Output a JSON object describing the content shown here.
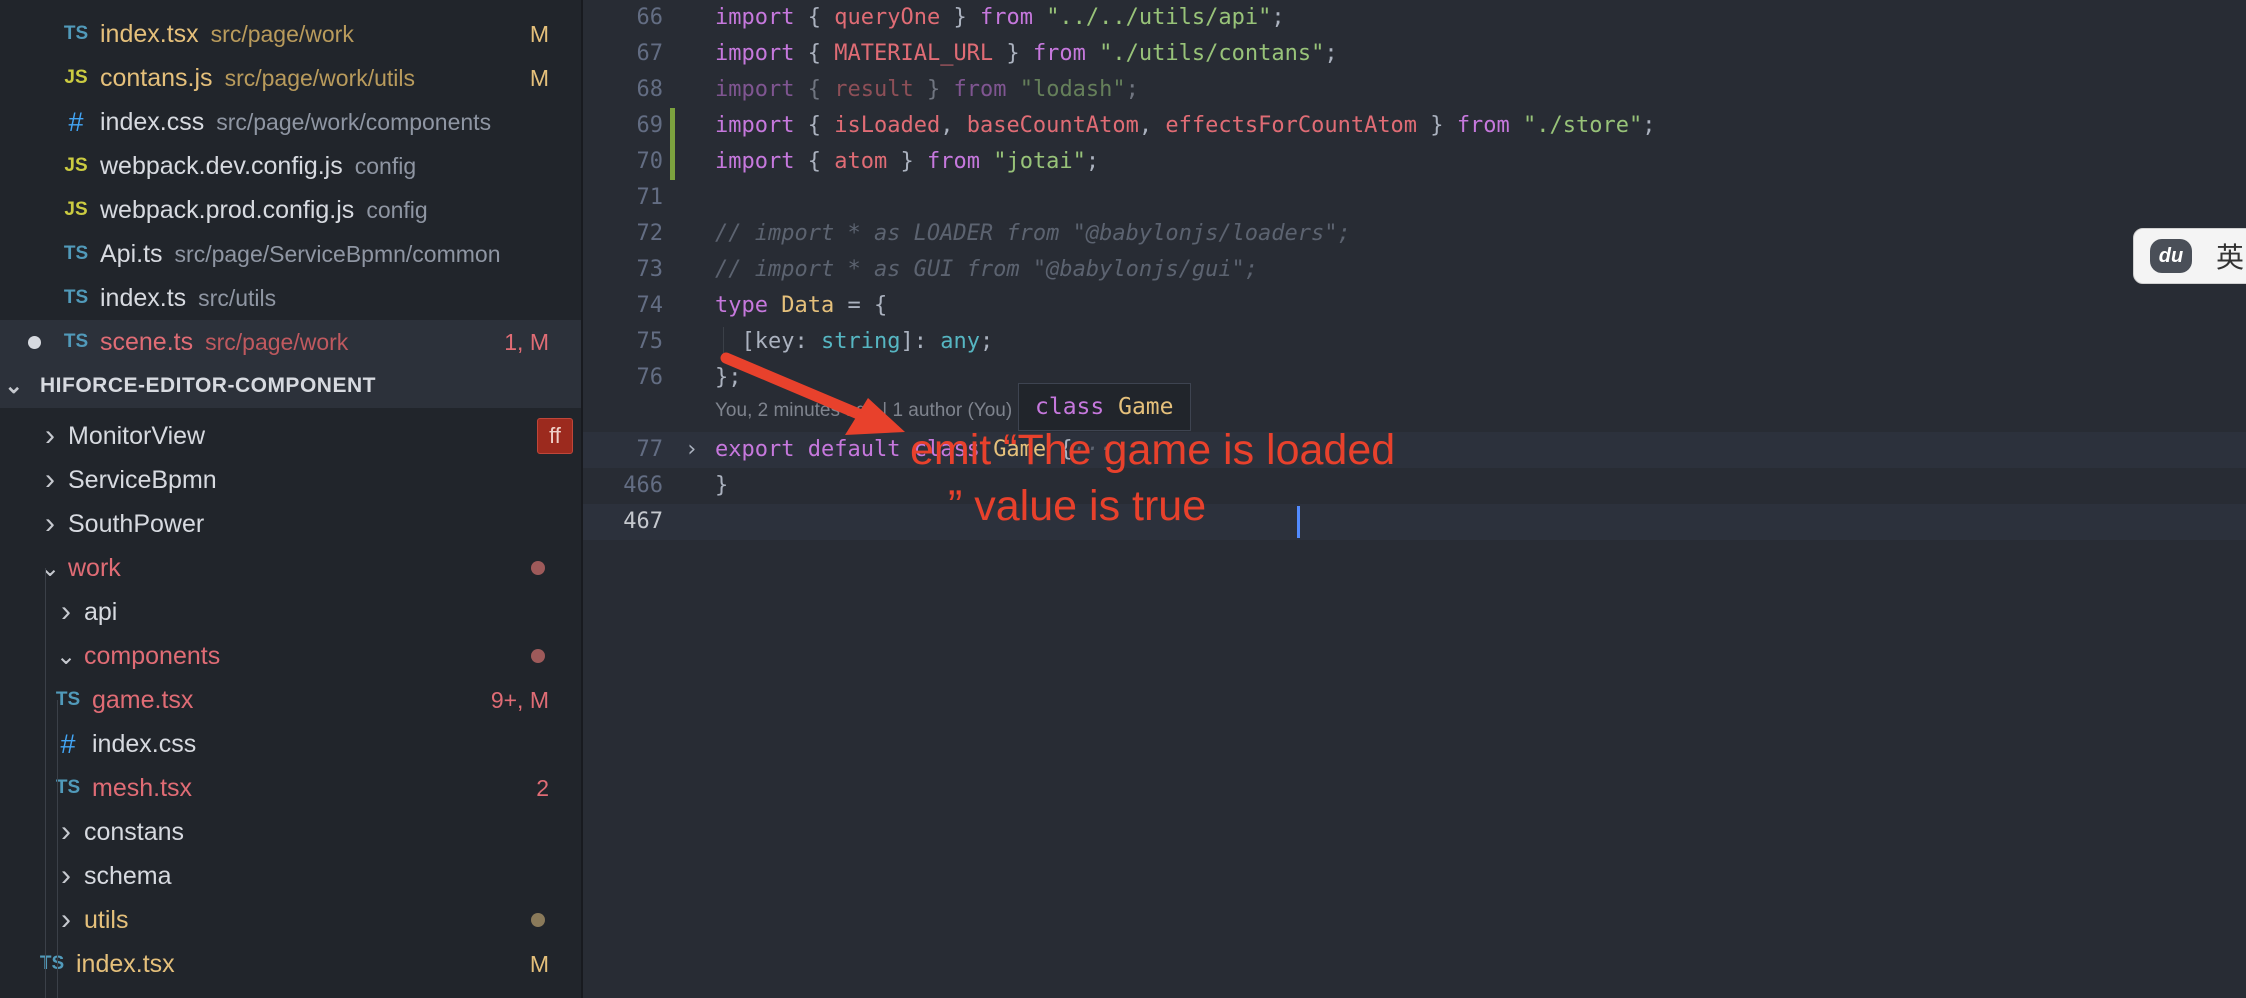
{
  "sidebar": {
    "open_files": [
      {
        "icon": "TS",
        "name": "index.tsx",
        "path": "src/page/work",
        "status": "M",
        "name_color": "#e5c07b",
        "path_color": "#b99b5c",
        "status_color": "#e5c07b"
      },
      {
        "icon": "JS",
        "name": "contans.js",
        "path": "src/page/work/utils",
        "status": "M",
        "name_color": "#e5c07b",
        "path_color": "#b99b5c",
        "status_color": "#e5c07b"
      },
      {
        "icon": "#",
        "name": "index.css",
        "path": "src/page/work/components",
        "status": "",
        "name_color": "#d7dae0",
        "path_color": "#8f96a3"
      },
      {
        "icon": "JS",
        "name": "webpack.dev.config.js",
        "path": "config",
        "status": "",
        "name_color": "#d7dae0",
        "path_color": "#8f96a3"
      },
      {
        "icon": "JS",
        "name": "webpack.prod.config.js",
        "path": "config",
        "status": "",
        "name_color": "#d7dae0",
        "path_color": "#8f96a3"
      },
      {
        "icon": "TS",
        "name": "Api.ts",
        "path": "src/page/ServiceBpmn/common",
        "status": "",
        "name_color": "#d7dae0",
        "path_color": "#8f96a3"
      },
      {
        "icon": "TS",
        "name": "index.ts",
        "path": "src/utils",
        "status": "",
        "name_color": "#d7dae0",
        "path_color": "#8f96a3"
      },
      {
        "icon": "TS",
        "name": "scene.ts",
        "path": "src/page/work",
        "status": "1, M",
        "name_color": "#e06c75",
        "path_color": "#c0595f",
        "status_color": "#e06c75",
        "active": true
      }
    ],
    "section_title": "HIFORCE-EDITOR-COMPONENT",
    "tree": [
      {
        "chevron": "›",
        "name": "MonitorView",
        "badge": "ff",
        "color": "#d7dae0"
      },
      {
        "chevron": "›",
        "name": "ServiceBpmn",
        "color": "#d7dae0"
      },
      {
        "chevron": "›",
        "name": "SouthPower",
        "color": "#d7dae0"
      },
      {
        "chevron": "⌄",
        "name": "work",
        "color": "#e06c75",
        "dot": "#9e5a5a"
      },
      {
        "chevron": "›",
        "name": "api",
        "color": "#d7dae0"
      },
      {
        "chevron": "⌄",
        "name": "components",
        "color": "#e06c75",
        "dot": "#9e5a5a"
      },
      {
        "icon": "TS",
        "name": "game.tsx",
        "color": "#e06c75",
        "status": "9+, M",
        "status_color": "#e06c75"
      },
      {
        "icon": "#",
        "name": "index.css",
        "color": "#d7dae0"
      },
      {
        "icon": "TS",
        "name": "mesh.tsx",
        "color": "#e06c75",
        "status": "2",
        "status_color": "#e06c75"
      },
      {
        "chevron": "›",
        "name": "constans",
        "color": "#d7dae0"
      },
      {
        "chevron": "›",
        "name": "schema",
        "color": "#d7dae0"
      },
      {
        "chevron": "›",
        "name": "utils",
        "color": "#e5c07b",
        "dot": "#8a7a5a"
      },
      {
        "icon": "TS",
        "name": "index.tsx",
        "color": "#e5c07b",
        "status": "M",
        "status_color": "#e5c07b"
      }
    ]
  },
  "editor": {
    "lines": [
      {
        "num": "66",
        "tokens": [
          [
            "k",
            "import"
          ],
          [
            "p",
            " { "
          ],
          [
            "f",
            "queryOne"
          ],
          [
            "p",
            " } "
          ],
          [
            "k",
            "from"
          ],
          [
            "p",
            " "
          ],
          [
            "s",
            "\"../../utils/api\""
          ],
          [
            "p",
            ";"
          ]
        ]
      },
      {
        "num": "67",
        "tokens": [
          [
            "k",
            "import"
          ],
          [
            "p",
            " { "
          ],
          [
            "f",
            "MATERIAL_URL"
          ],
          [
            "p",
            " } "
          ],
          [
            "k",
            "from"
          ],
          [
            "p",
            " "
          ],
          [
            "s",
            "\"./utils/contans\""
          ],
          [
            "p",
            ";"
          ]
        ]
      },
      {
        "num": "68",
        "dim": true,
        "tokens": [
          [
            "k",
            "import"
          ],
          [
            "p",
            " { "
          ],
          [
            "f",
            "result"
          ],
          [
            "p",
            " } "
          ],
          [
            "k",
            "from"
          ],
          [
            "p",
            " "
          ],
          [
            "s",
            "\"lodash\""
          ],
          [
            "p",
            ";"
          ]
        ]
      },
      {
        "num": "69",
        "tokens": [
          [
            "k",
            "import"
          ],
          [
            "p",
            " { "
          ],
          [
            "f",
            "isLoaded"
          ],
          [
            "p",
            ", "
          ],
          [
            "f",
            "baseCountAtom"
          ],
          [
            "p",
            ", "
          ],
          [
            "f",
            "effectsForCountAtom"
          ],
          [
            "p",
            " } "
          ],
          [
            "k",
            "from"
          ],
          [
            "p",
            " "
          ],
          [
            "s",
            "\"./store\""
          ],
          [
            "p",
            ";"
          ]
        ]
      },
      {
        "num": "70",
        "tokens": [
          [
            "k",
            "import"
          ],
          [
            "p",
            " { "
          ],
          [
            "f",
            "atom"
          ],
          [
            "p",
            " } "
          ],
          [
            "k",
            "from"
          ],
          [
            "p",
            " "
          ],
          [
            "s",
            "\"jotai\""
          ],
          [
            "p",
            ";"
          ]
        ]
      },
      {
        "num": "71",
        "tokens": []
      },
      {
        "num": "72",
        "tokens": [
          [
            "c",
            "// import * as LOADER from \"@babylonjs/loaders\";"
          ]
        ]
      },
      {
        "num": "73",
        "tokens": [
          [
            "c",
            "// import * as GUI from \"@babylonjs/gui\";"
          ]
        ]
      },
      {
        "num": "74",
        "tokens": [
          [
            "k",
            "type"
          ],
          [
            "p",
            " "
          ],
          [
            "t",
            "Data"
          ],
          [
            "p",
            " = {"
          ]
        ]
      },
      {
        "num": "75",
        "tokens": [
          [
            "p",
            "  ["
          ],
          [
            "v",
            "key"
          ],
          [
            "p",
            ": "
          ],
          [
            "ty",
            "string"
          ],
          [
            "p",
            "]: "
          ],
          [
            "ty",
            "any"
          ],
          [
            "p",
            ";"
          ]
        ]
      },
      {
        "num": "76",
        "tokens": [
          [
            "p",
            "};"
          ]
        ]
      },
      {
        "num": "77",
        "tokens": [
          [
            "k",
            "export"
          ],
          [
            "p",
            " "
          ],
          [
            "k",
            "default"
          ],
          [
            "p",
            " "
          ],
          [
            "k",
            "class"
          ],
          [
            "p",
            " "
          ],
          [
            "t",
            "Game"
          ],
          [
            "p",
            " {"
          ],
          [
            "c",
            "···"
          ]
        ]
      },
      {
        "num": "466",
        "tokens": [
          [
            "p",
            "}"
          ]
        ]
      },
      {
        "num": "467",
        "tokens": []
      }
    ],
    "blame": "You, 2 minutes ago | 1 author (You)",
    "hover": {
      "keyword": "class",
      "name": "Game"
    }
  },
  "annotation": {
    "line1": "emit “The game is loaded",
    "line2": "” value is true",
    "color": "#e8412c"
  },
  "ime": {
    "logo": "du",
    "lang": "英"
  }
}
